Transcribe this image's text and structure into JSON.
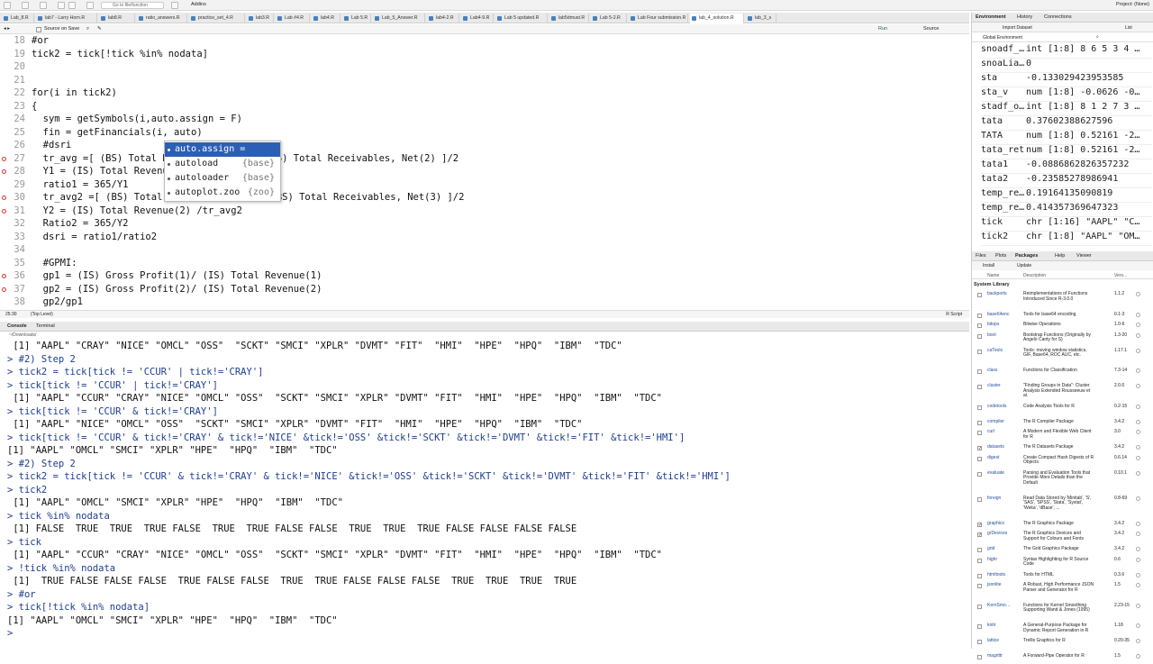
{
  "toolbar": {
    "goto_placeholder": "Go to file/function",
    "addins": "Addins",
    "project": "Project: (None)"
  },
  "tabs": [
    "Lab_8.R",
    "lab7 - Larry Horn.R",
    "lab8.R",
    "ratio_answers.R",
    "practice_set_4.R",
    "lab3.R",
    "Lab #4.R",
    "lab4.R",
    "Lab 5.R",
    "Lab_5_Answer.R",
    "lab4-2.R",
    "Lab4-9.R",
    "Lab 5 updated.R",
    "lab5dmust.R",
    "Lab 5-2.R",
    "Lab Four submission.R",
    "lab_4_solution.R",
    "lab_3_s"
  ],
  "editor_toolbar": {
    "source_on_save": "Source on Save",
    "run": "Run",
    "source": "Source"
  },
  "editor_lines": [
    {
      "n": "18",
      "code": "#or",
      "bp": false
    },
    {
      "n": "19",
      "code": "tick2 = tick[!tick %in% nodata]",
      "bp": false
    },
    {
      "n": "20",
      "code": "",
      "bp": false
    },
    {
      "n": "21",
      "code": "",
      "bp": false
    },
    {
      "n": "22",
      "code": "for(i in tick2)",
      "bp": false
    },
    {
      "n": "23",
      "code": "{",
      "bp": false
    },
    {
      "n": "24",
      "code": "  sym = getSymbols(i,auto.assign = F)",
      "bp": false
    },
    {
      "n": "25",
      "code": "  fin = getFinancials(i, auto)",
      "bp": false
    },
    {
      "n": "26",
      "code": "  #dsri",
      "bp": false
    },
    {
      "n": "27",
      "code": "  tr_avg =[ (BS) Total Re                  S) Total Receivables, Net(2) ]/2",
      "bp": true
    },
    {
      "n": "28",
      "code": "  Y1 = (IS) Total Revenue",
      "bp": true
    },
    {
      "n": "29",
      "code": "  ratio1 = 365/Y1",
      "bp": false
    },
    {
      "n": "30",
      "code": "  tr_avg2 =[ (BS) Total R                  BS) Total Receivables, Net(3) ]/2",
      "bp": true
    },
    {
      "n": "31",
      "code": "  Y2 = (IS) Total Revenue(2) /tr_avg2",
      "bp": true
    },
    {
      "n": "32",
      "code": "  Ratio2 = 365/Y2",
      "bp": false
    },
    {
      "n": "33",
      "code": "  dsri = ratio1/ratio2",
      "bp": false
    },
    {
      "n": "34",
      "code": "",
      "bp": false
    },
    {
      "n": "35",
      "code": "  #GPMI:",
      "bp": false
    },
    {
      "n": "36",
      "code": "  gp1 = (IS) Gross Profit(1)/ (IS) Total Revenue(1)",
      "bp": true
    },
    {
      "n": "37",
      "code": "  gp2 = (IS) Gross Profit(2)/ (IS) Total Revenue(2)",
      "bp": true
    },
    {
      "n": "38",
      "code": "  gp2/gp1",
      "bp": false
    }
  ],
  "autocomplete": [
    {
      "name": "auto.assign =",
      "pkg": ""
    },
    {
      "name": "autoload",
      "pkg": "{base}"
    },
    {
      "name": "autoloader",
      "pkg": "{base}"
    },
    {
      "name": "autoplot.zoo",
      "pkg": "{zoo}"
    }
  ],
  "status": {
    "pos": "25:30",
    "scope": "(Top Level)",
    "type": "R Script"
  },
  "console_tabs": {
    "console": "Console",
    "terminal": "Terminal"
  },
  "console_path": "~/Downloads/",
  "console_lines": [
    {
      "t": "out",
      "s": " [1] \"AAPL\" \"CRAY\" \"NICE\" \"OMCL\" \"OSS\"  \"SCKT\" \"SMCI\" \"XPLR\" \"DVMT\" \"FIT\"  \"HMI\"  \"HPE\"  \"HPQ\"  \"IBM\"  \"TDC\""
    },
    {
      "t": "cmd",
      "s": "> #2) Step 2"
    },
    {
      "t": "cmd",
      "s": "> tick2 = tick[tick != 'CCUR' | tick!='CRAY']"
    },
    {
      "t": "cmd",
      "s": "> tick[tick != 'CCUR' | tick!='CRAY']"
    },
    {
      "t": "out",
      "s": " [1] \"AAPL\" \"CCUR\" \"CRAY\" \"NICE\" \"OMCL\" \"OSS\"  \"SCKT\" \"SMCI\" \"XPLR\" \"DVMT\" \"FIT\"  \"HMI\"  \"HPE\"  \"HPQ\"  \"IBM\"  \"TDC\""
    },
    {
      "t": "cmd",
      "s": "> tick[tick != 'CCUR' & tick!='CRAY']"
    },
    {
      "t": "out",
      "s": " [1] \"AAPL\" \"NICE\" \"OMCL\" \"OSS\"  \"SCKT\" \"SMCI\" \"XPLR\" \"DVMT\" \"FIT\"  \"HMI\"  \"HPE\"  \"HPQ\"  \"IBM\"  \"TDC\""
    },
    {
      "t": "cmd",
      "s": "> tick[tick != 'CCUR' & tick!='CRAY' & tick!='NICE' &tick!='OSS' &tick!='SCKT' &tick!='DVMT' &tick!='FIT' &tick!='HMI']"
    },
    {
      "t": "out",
      "s": "[1] \"AAPL\" \"OMCL\" \"SMCI\" \"XPLR\" \"HPE\"  \"HPQ\"  \"IBM\"  \"TDC\""
    },
    {
      "t": "cmd",
      "s": "> #2) Step 2"
    },
    {
      "t": "cmd",
      "s": "> tick2 = tick[tick != 'CCUR' & tick!='CRAY' & tick!='NICE' &tick!='OSS' &tick!='SCKT' &tick!='DVMT' &tick!='FIT' &tick!='HMI']"
    },
    {
      "t": "cmd",
      "s": "> tick2"
    },
    {
      "t": "out",
      "s": " [1] \"AAPL\" \"OMCL\" \"SMCI\" \"XPLR\" \"HPE\"  \"HPQ\"  \"IBM\"  \"TDC\""
    },
    {
      "t": "cmd",
      "s": "> tick %in% nodata"
    },
    {
      "t": "out",
      "s": " [1] FALSE  TRUE  TRUE  TRUE FALSE  TRUE  TRUE FALSE FALSE  TRUE  TRUE  TRUE FALSE FALSE FALSE FALSE"
    },
    {
      "t": "cmd",
      "s": "> tick"
    },
    {
      "t": "out",
      "s": " [1] \"AAPL\" \"CCUR\" \"CRAY\" \"NICE\" \"OMCL\" \"OSS\"  \"SCKT\" \"SMCI\" \"XPLR\" \"DVMT\" \"FIT\"  \"HMI\"  \"HPE\"  \"HPQ\"  \"IBM\"  \"TDC\""
    },
    {
      "t": "cmd",
      "s": "> !tick %in% nodata"
    },
    {
      "t": "out",
      "s": " [1]  TRUE FALSE FALSE FALSE  TRUE FALSE FALSE  TRUE  TRUE FALSE FALSE FALSE  TRUE  TRUE  TRUE  TRUE"
    },
    {
      "t": "cmd",
      "s": "> #or"
    },
    {
      "t": "cmd",
      "s": "> tick[!tick %in% nodata]"
    },
    {
      "t": "out",
      "s": "[1] \"AAPL\" \"OMCL\" \"SMCI\" \"XPLR\" \"HPE\"  \"HPQ\"  \"IBM\"  \"TDC\""
    },
    {
      "t": "cmd",
      "s": ">"
    }
  ],
  "env_tabs": {
    "environment": "Environment",
    "history": "History",
    "connections": "Connections"
  },
  "env_toolbar": {
    "import": "Import Dataset",
    "scope": "Global Environment",
    "view": "List"
  },
  "env_rows": [
    {
      "name": "snoadf_…",
      "val": "int [1:8] 8 6 5 3 4 …"
    },
    {
      "name": "snoaLia…",
      "val": "0"
    },
    {
      "name": "sta",
      "val": "-0.133029423953585"
    },
    {
      "name": "sta_v",
      "val": "num [1:8] -0.0626 -0…"
    },
    {
      "name": "stadf_o…",
      "val": "int [1:8] 8 1 2 7 3 …"
    },
    {
      "name": "tata",
      "val": "0.37602388627596"
    },
    {
      "name": "TATA",
      "val": "num [1:8] 0.52161 -2…"
    },
    {
      "name": "tata_ret",
      "val": "num [1:8] 0.52161 -2…"
    },
    {
      "name": "tata1",
      "val": "-0.0886862826357232"
    },
    {
      "name": "tata2",
      "val": "-0.23585278986941"
    },
    {
      "name": "temp_re…",
      "val": "0.19164135090819"
    },
    {
      "name": "temp_re…",
      "val": "0.414357369647323"
    },
    {
      "name": "tick",
      "val": "chr [1:16] \"AAPL\" \"C…"
    },
    {
      "name": "tick2",
      "val": "chr [1:8] \"AAPL\" \"OM…"
    }
  ],
  "files_tabs": {
    "files": "Files",
    "plots": "Plots",
    "packages": "Packages",
    "help": "Help",
    "viewer": "Viewer"
  },
  "files_toolbar": {
    "install": "Install",
    "update": "Update"
  },
  "pkg_header": {
    "name": "Name",
    "desc": "Description",
    "ver": "Vers..."
  },
  "system_library": "System Library",
  "packages": [
    {
      "name": "backports",
      "desc": "Reimplementations of Functions Introduced Since R-3.0.0",
      "ver": "1.1.2",
      "checked": false,
      "lines": 3
    },
    {
      "name": "base64enc",
      "desc": "Tools for base64 encoding",
      "ver": "0.1-3",
      "checked": false,
      "lines": 1
    },
    {
      "name": "bitops",
      "desc": "Bitwise Operations",
      "ver": "1.0-6",
      "checked": false,
      "lines": 1
    },
    {
      "name": "boot",
      "desc": "Bootstrap Functions (Originally by Angelo Canty for S)",
      "ver": "1.3-20",
      "checked": false,
      "lines": 2
    },
    {
      "name": "caTools",
      "desc": "Tools: moving window statistics, GIF, Base64, ROC AUC, etc.",
      "ver": "1.17.1",
      "checked": false,
      "lines": 3
    },
    {
      "name": "class",
      "desc": "Functions for Classification",
      "ver": "7.3-14",
      "checked": false,
      "lines": 2
    },
    {
      "name": "cluster",
      "desc": "\"Finding Groups in Data\": Cluster Analysis Extended Rousseeuw et al.",
      "ver": "2.0.6",
      "checked": false,
      "lines": 3
    },
    {
      "name": "codetools",
      "desc": "Code Analysis Tools for R",
      "ver": "0.2-15",
      "checked": false,
      "lines": 2
    },
    {
      "name": "compiler",
      "desc": "The R Compiler Package",
      "ver": "3.4.2",
      "checked": false,
      "lines": 1
    },
    {
      "name": "curl",
      "desc": "A Modern and Flexible Web Client for R",
      "ver": "3.0",
      "checked": false,
      "lines": 2
    },
    {
      "name": "datasets",
      "desc": "The R Datasets Package",
      "ver": "3.4.2",
      "checked": true,
      "lines": 1
    },
    {
      "name": "digest",
      "desc": "Create Compact Hash Digests of R Objects",
      "ver": "0.6.14",
      "checked": false,
      "lines": 2
    },
    {
      "name": "evaluate",
      "desc": "Parsing and Evaluation Tools that Provide More Details than the Default",
      "ver": "0.10.1",
      "checked": false,
      "lines": 4
    },
    {
      "name": "foreign",
      "desc": "Read Data Stored by 'Minitab', 'S', 'SAS', 'SPSS', 'Stata', 'Systat', 'Weka', 'dBase', ...",
      "ver": "0.8-69",
      "checked": false,
      "lines": 4
    },
    {
      "name": "graphics",
      "desc": "The R Graphics Package",
      "ver": "3.4.2",
      "checked": true,
      "lines": 1
    },
    {
      "name": "grDevices",
      "desc": "The R Graphics Devices and Support for Colours and Fonts",
      "ver": "3.4.2",
      "checked": true,
      "lines": 2
    },
    {
      "name": "grid",
      "desc": "The Grid Graphics Package",
      "ver": "3.4.2",
      "checked": false,
      "lines": 1
    },
    {
      "name": "highr",
      "desc": "Syntax Highlighting for R Source Code",
      "ver": "0.6",
      "checked": false,
      "lines": 2
    },
    {
      "name": "htmltools",
      "desc": "Tools for HTML",
      "ver": "0.3.6",
      "checked": false,
      "lines": 1
    },
    {
      "name": "jsonlite",
      "desc": "A Robust, High Performance JSON Parser and Generator for R",
      "ver": "1.5",
      "checked": false,
      "lines": 3
    },
    {
      "name": "KernSmo…",
      "desc": "Functions for Kernel Smoothing Supporting Wand & Jones (1995)",
      "ver": "2.23-15",
      "checked": false,
      "lines": 3
    },
    {
      "name": "knitr",
      "desc": "A General-Purpose Package for Dynamic Report Generation in R",
      "ver": "1.18",
      "checked": false,
      "lines": 2
    },
    {
      "name": "lattice",
      "desc": "Trellis Graphics for R",
      "ver": "0.20-35",
      "checked": false,
      "lines": 2
    },
    {
      "name": "magrittr",
      "desc": "A Forward-Pipe Operator for R",
      "ver": "1.5",
      "checked": false,
      "lines": 1
    }
  ]
}
